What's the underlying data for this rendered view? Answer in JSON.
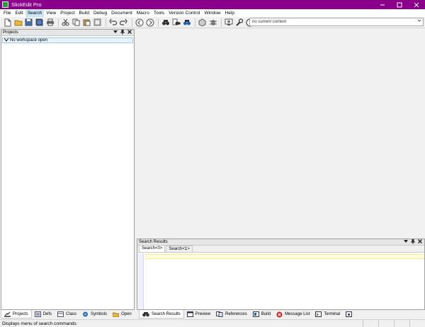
{
  "window": {
    "title": "SlickEdit Pro"
  },
  "menu": [
    "File",
    "Edit",
    "Search",
    "View",
    "Project",
    "Build",
    "Debug",
    "Document",
    "Macro",
    "Tools",
    "Version Control",
    "Window",
    "Help"
  ],
  "context": {
    "value": "no current context"
  },
  "projects": {
    "title": "Projects",
    "tree_item": "No workspace open"
  },
  "search_results": {
    "title": "Search Results",
    "tabs": [
      "Search<0>",
      "Search<1>"
    ]
  },
  "left_tabs": [
    "Projects",
    "Defs",
    "Class",
    "Symbols",
    "Open"
  ],
  "bottom_tabs": [
    "Search Results",
    "Preview",
    "References",
    "Build",
    "Message List",
    "Terminal"
  ],
  "status": {
    "message": "Displays menu of search commands"
  },
  "colors": {
    "titlebar": "#8b008b",
    "menu_highlight": "#cce4f7",
    "current_line": "#fffbd6"
  }
}
